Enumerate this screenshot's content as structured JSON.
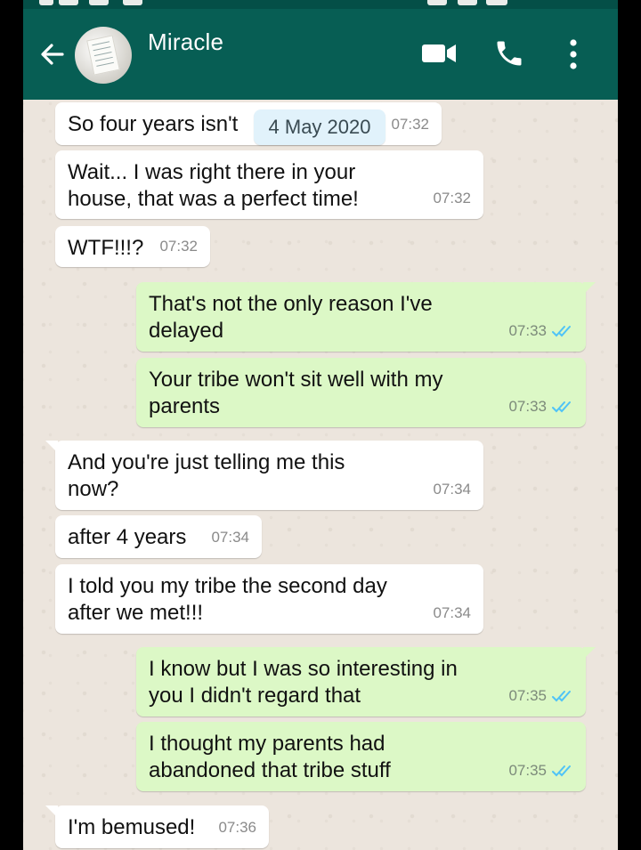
{
  "header": {
    "contact_name": "Miracle",
    "back_icon": "arrow-left-icon",
    "video_icon": "video-camera-icon",
    "call_icon": "phone-icon",
    "menu_icon": "more-vertical-icon",
    "header_color": "#075e54"
  },
  "date_chip": "4 May 2020",
  "messages": [
    {
      "dir": "in",
      "text": "So four years isn't",
      "time": "07:32"
    },
    {
      "dir": "in",
      "text": "Wait... I was right there in your\nhouse, that was a perfect time!",
      "time": "07:32"
    },
    {
      "dir": "in",
      "text": "WTF!!!?",
      "time": "07:32"
    },
    {
      "dir": "out",
      "text": "That's not the only reason I've\ndelayed",
      "time": "07:33",
      "status": "read"
    },
    {
      "dir": "out",
      "text": "Your tribe won't sit well with my\nparents",
      "time": "07:33",
      "status": "read"
    },
    {
      "dir": "in",
      "text": "And you're just telling me this\nnow?",
      "time": "07:34"
    },
    {
      "dir": "in",
      "text": "after 4 years",
      "time": "07:34"
    },
    {
      "dir": "in",
      "text": "I told you my tribe the second day\nafter we met!!!",
      "time": "07:34"
    },
    {
      "dir": "out",
      "text": "I know but I was so interesting in\nyou I didn't regard that",
      "time": "07:35",
      "status": "read"
    },
    {
      "dir": "out",
      "text": "I thought my parents had\nabandoned that tribe stuff",
      "time": "07:35",
      "status": "read"
    },
    {
      "dir": "in",
      "text": "I'm bemused!",
      "time": "07:36"
    }
  ],
  "colors": {
    "incoming": "#ffffff",
    "outgoing": "#dcf8c6",
    "read_ticks": "#4fc3f7",
    "chat_background": "#ece5dd"
  }
}
